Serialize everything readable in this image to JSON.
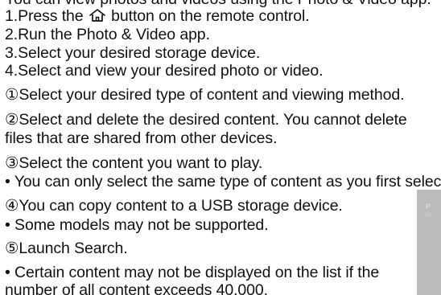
{
  "lines": {
    "intro": "You can view photos and videos using the Photo & Video app.",
    "step1_before": "1.Press the ",
    "step1_after": " button on the remote control.",
    "step2": "2.Run the Photo & Video app.",
    "step3": "3.Select your desired storage device.",
    "step4": "4.Select and view your desired photo or video.",
    "note1": "①Select your desired type of content and viewing method.",
    "note2a": "②Select and delete the desired content. You cannot delete",
    "note2b": "files that are shared from other devices.",
    "note3": "③Select the content you want to play.",
    "bullet3": "• You can only select the same type of content as you first selected.",
    "note4": "④You can copy content to a USB storage device.",
    "bullet4": "• Some models may not be supported.",
    "note5": "⑤Launch Search.",
    "bullet5a": "• Certain content may not be displayed on the list if the",
    "bullet5b": "number of all content exceeds 40,000."
  },
  "icons": {
    "home": "home-icon"
  },
  "thumbnail": {
    "title": "P",
    "subtitle": "23"
  }
}
